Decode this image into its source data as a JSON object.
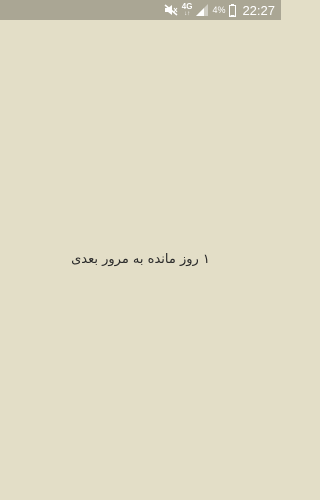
{
  "status_bar": {
    "network_type": "4G",
    "network_arrows": "↓↑",
    "battery_percent": "4%",
    "time": "22:27",
    "icons": [
      "mute-icon",
      "network-4g-icon",
      "signal-icon",
      "battery-icon"
    ]
  },
  "main": {
    "message": "۱ روز مانده به مرور بعدی"
  },
  "colors": {
    "background": "#e3dec7",
    "status_bar": "#aaa694",
    "text": "#2a2a2a"
  }
}
